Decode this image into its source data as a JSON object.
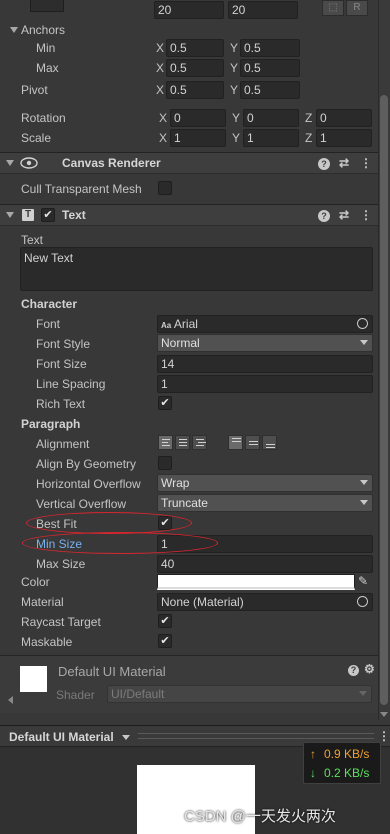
{
  "rect": {
    "size_w": "20",
    "size_h": "20",
    "r_label": "R",
    "anchors_label": "Anchors",
    "min_label": "Min",
    "min_x": "0.5",
    "min_y": "0.5",
    "max_label": "Max",
    "max_x": "0.5",
    "max_y": "0.5",
    "pivot_label": "Pivot",
    "pivot_x": "0.5",
    "pivot_y": "0.5",
    "rotation_label": "Rotation",
    "rot_x": "0",
    "rot_y": "0",
    "rot_z": "0",
    "scale_label": "Scale",
    "scale_x": "1",
    "scale_y": "1",
    "scale_z": "1",
    "axis_x": "X",
    "axis_y": "Y",
    "axis_z": "Z"
  },
  "canvas_renderer": {
    "title": "Canvas Renderer",
    "cull_label": "Cull Transparent Mesh"
  },
  "text_component": {
    "title": "Text",
    "text_label": "Text",
    "text_value": "New Text",
    "character_label": "Character",
    "font_label": "Font",
    "font_value": "Arial",
    "font_icon_text": "Aa",
    "font_style_label": "Font Style",
    "font_style_value": "Normal",
    "font_size_label": "Font Size",
    "font_size_value": "14",
    "line_spacing_label": "Line Spacing",
    "line_spacing_value": "1",
    "rich_text_label": "Rich Text",
    "paragraph_label": "Paragraph",
    "alignment_label": "Alignment",
    "align_geom_label": "Align By Geometry",
    "h_overflow_label": "Horizontal Overflow",
    "h_overflow_value": "Wrap",
    "v_overflow_label": "Vertical Overflow",
    "v_overflow_value": "Truncate",
    "best_fit_label": "Best Fit",
    "min_size_label": "Min Size",
    "min_size_value": "1",
    "max_size_label": "Max Size",
    "max_size_value": "40",
    "color_label": "Color",
    "material_label": "Material",
    "material_value": "None (Material)",
    "raycast_label": "Raycast Target",
    "maskable_label": "Maskable"
  },
  "material_section": {
    "name": "Default UI Material",
    "shader_label": "Shader",
    "shader_value": "UI/Default"
  },
  "preview": {
    "title": "Default UI Material"
  },
  "network": {
    "up": "0.9 KB/s",
    "down": "0.2 KB/s",
    "up_arrow": "↑",
    "down_arrow": "↓"
  },
  "watermark": "CSDN @一天发火两次",
  "colors": {
    "accent_blue": "#7ab2f0",
    "annotation_red": "#d9262e",
    "net_up": "#f0a030",
    "net_down": "#5ee05e"
  }
}
